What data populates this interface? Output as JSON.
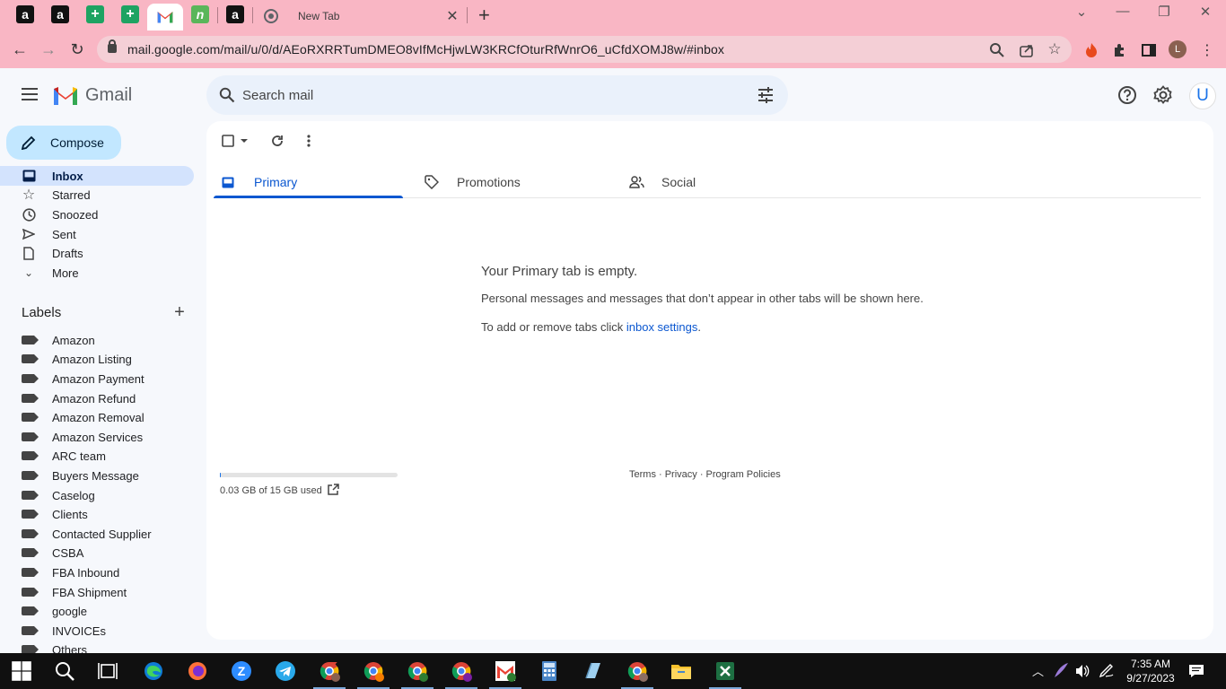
{
  "browser": {
    "tabs": [
      {
        "icon": "amazon-icon",
        "label": "a"
      },
      {
        "icon": "amazon-icon",
        "label": "a"
      },
      {
        "icon": "sheets-icon",
        "label": "+"
      },
      {
        "icon": "sheets-icon",
        "label": "+"
      },
      {
        "icon": "gmail-icon",
        "label": ""
      },
      {
        "icon": "green-app-icon",
        "label": "n"
      },
      {
        "icon": "amazon-icon",
        "label": "a"
      }
    ],
    "new_tab_title": "New Tab",
    "url": "mail.google.com/mail/u/0/d/AEoRXRRTumDMEO8vIfMcHjwLW3KRCfOturRfWnrO6_uCfdXOMJ8w/#inbox",
    "profile_initial": "L"
  },
  "gmail": {
    "logo_text": "Gmail",
    "search_placeholder": "Search mail",
    "account_initial": "U",
    "compose_label": "Compose",
    "nav": [
      {
        "label": "Inbox",
        "icon": "inbox-icon",
        "active": true
      },
      {
        "label": "Starred",
        "icon": "star-icon"
      },
      {
        "label": "Snoozed",
        "icon": "clock-icon"
      },
      {
        "label": "Sent",
        "icon": "send-icon"
      },
      {
        "label": "Drafts",
        "icon": "draft-icon"
      },
      {
        "label": "More",
        "icon": "chevron-down-icon"
      }
    ],
    "labels_header": "Labels",
    "labels": [
      "Amazon",
      "Amazon Listing",
      "Amazon Payment",
      "Amazon Refund",
      "Amazon Removal",
      "Amazon Services",
      "ARC team",
      "Buyers Message",
      "Caselog",
      "Clients",
      "Contacted Supplier",
      "CSBA",
      "FBA Inbound",
      "FBA Shipment",
      "google",
      "INVOICEs",
      "Others"
    ],
    "category_tabs": [
      {
        "label": "Primary",
        "icon": "inbox-tab-icon",
        "active": true
      },
      {
        "label": "Promotions",
        "icon": "tag-icon"
      },
      {
        "label": "Social",
        "icon": "people-icon"
      }
    ],
    "empty": {
      "title": "Your Primary tab is empty.",
      "body": "Personal messages and messages that don’t appear in other tabs will be shown here.",
      "hint_prefix": "To add or remove tabs click ",
      "hint_link": "inbox settings",
      "hint_suffix": "."
    },
    "storage": {
      "text": "0.03 GB of 15 GB used",
      "used_fraction": 0.002
    },
    "footer": "Terms · Privacy · Program Policies"
  },
  "taskbar": {
    "time": "7:35 AM",
    "date": "9/27/2023"
  },
  "colors": {
    "chrome_frame": "#f9b6c4",
    "compose_bg": "#c2e7ff",
    "active_nav": "#d3e3fd",
    "link_blue": "#0b57d0"
  }
}
